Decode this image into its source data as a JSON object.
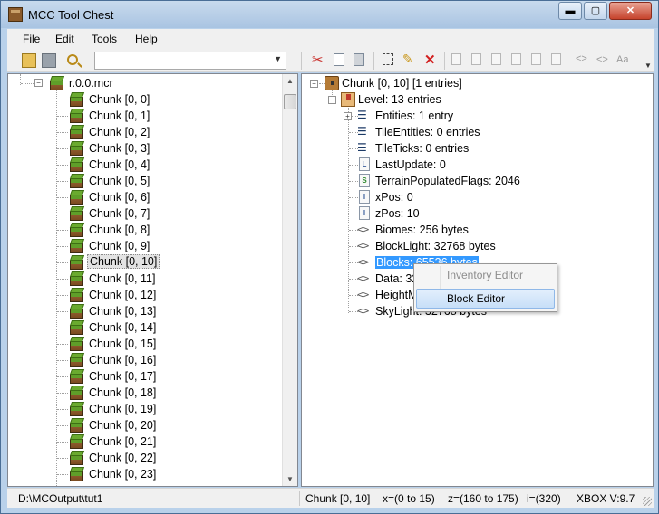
{
  "window": {
    "title": "MCC Tool Chest"
  },
  "window_controls": {
    "minimize": "▬",
    "maximize": "▢",
    "close": "✕"
  },
  "menu": [
    "File",
    "Edit",
    "Tools",
    "Help"
  ],
  "toolbar": {
    "search_combo_value": ""
  },
  "left_tree": {
    "root_label": "r.0.0.mcr",
    "chunks": [
      "Chunk [0, 0]",
      "Chunk [0, 1]",
      "Chunk [0, 2]",
      "Chunk [0, 3]",
      "Chunk [0, 4]",
      "Chunk [0, 5]",
      "Chunk [0, 6]",
      "Chunk [0, 7]",
      "Chunk [0, 8]",
      "Chunk [0, 9]",
      "Chunk [0, 10]",
      "Chunk [0, 11]",
      "Chunk [0, 12]",
      "Chunk [0, 13]",
      "Chunk [0, 14]",
      "Chunk [0, 15]",
      "Chunk [0, 16]",
      "Chunk [0, 17]",
      "Chunk [0, 18]",
      "Chunk [0, 19]",
      "Chunk [0, 20]",
      "Chunk [0, 21]",
      "Chunk [0, 22]",
      "Chunk [0, 23]"
    ],
    "selected_chunk": "Chunk [0, 10]"
  },
  "right_tree": {
    "root_label": "Chunk [0, 10]   [1 entries]",
    "level_label": "Level: 13 entries",
    "children": [
      {
        "icon": "list",
        "label": "Entities: 1 entry",
        "expandable": true
      },
      {
        "icon": "list",
        "label": "TileEntities: 0 entries"
      },
      {
        "icon": "list",
        "label": "TileTicks: 0 entries"
      },
      {
        "icon": "long",
        "label": "LastUpdate: 0"
      },
      {
        "icon": "short",
        "label": "TerrainPopulatedFlags: 2046"
      },
      {
        "icon": "int",
        "label": "xPos: 0"
      },
      {
        "icon": "int",
        "label": "zPos: 10"
      },
      {
        "icon": "bytes",
        "label": "Biomes: 256 bytes"
      },
      {
        "icon": "bytes",
        "label": "BlockLight: 32768 bytes"
      },
      {
        "icon": "bytes",
        "label": "Blocks: 65536 bytes",
        "selected": true
      },
      {
        "icon": "bytes",
        "label": "Data: 32768 bytes"
      },
      {
        "icon": "bytes",
        "label": "HeightMap: 1024 bytes"
      },
      {
        "icon": "bytes",
        "label": "SkyLight: 32768 bytes"
      }
    ]
  },
  "context_menu": {
    "items": [
      "Inventory Editor",
      "Block Editor"
    ]
  },
  "status": {
    "path": "D:\\MCOutput\\tut1",
    "chunk": "Chunk [0, 10]",
    "x_range": "x=(0 to 15)",
    "z_range": "z=(160 to 175)",
    "index": "i=(320)",
    "version": "XBOX V:9.7"
  }
}
